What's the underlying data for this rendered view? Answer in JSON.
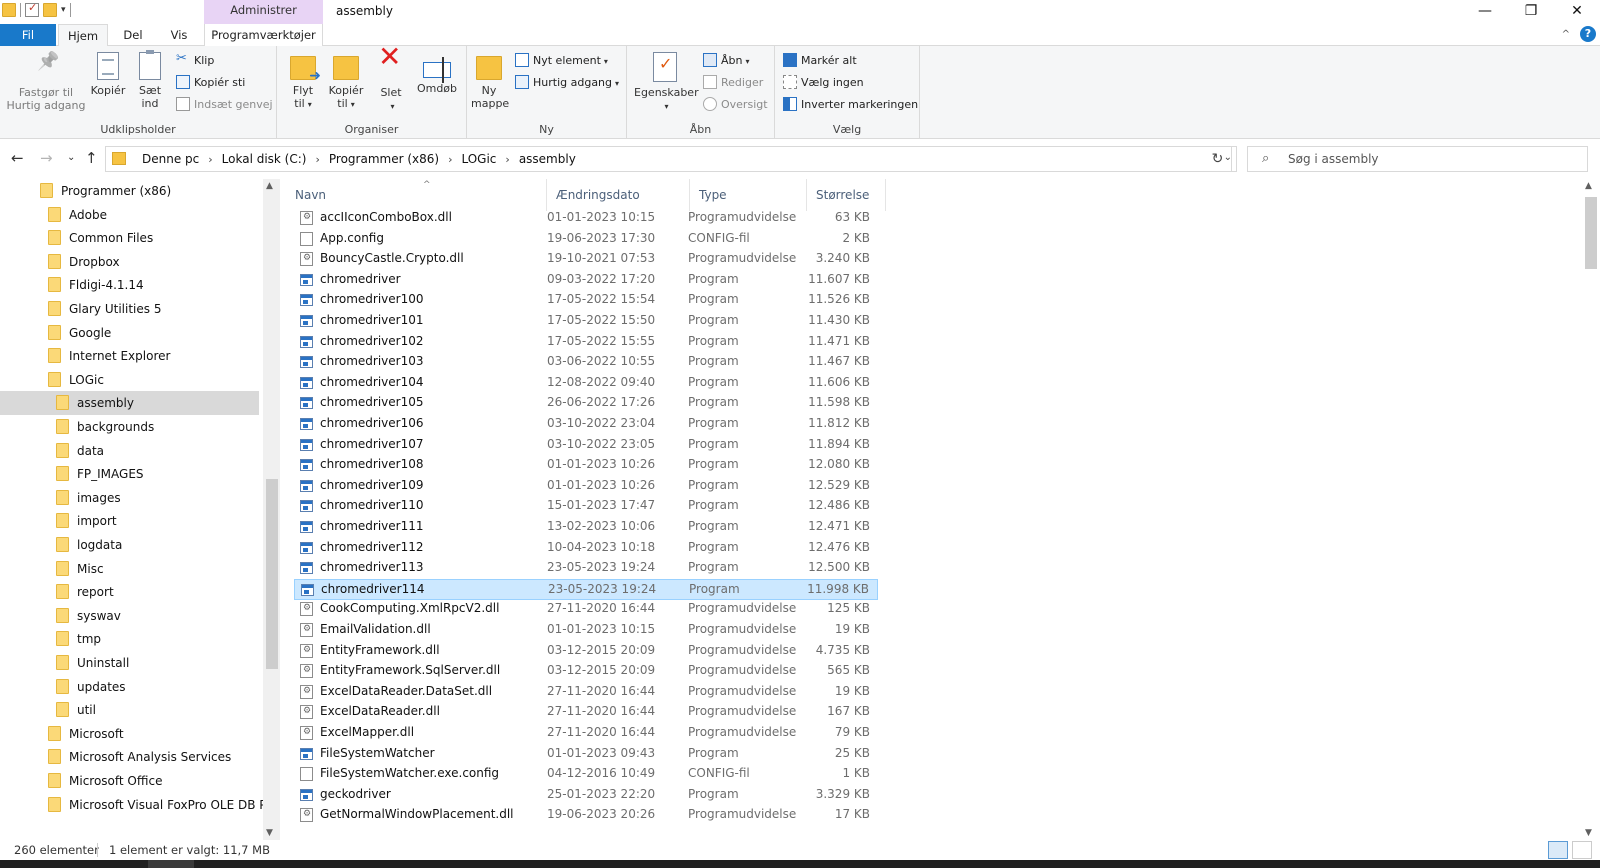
{
  "titlebar": {
    "title": "assembly",
    "context_tab": "Administrer",
    "minimize": "—",
    "maximize": "❐",
    "close": "✕"
  },
  "tabs": {
    "fil": "Fil",
    "hjem": "Hjem",
    "del": "Del",
    "vis": "Vis",
    "programvaerktojer": "Programværktøjer",
    "collapse": "^",
    "help": "?"
  },
  "ribbon": {
    "udklipsholder": {
      "label": "Udklipsholder",
      "pin_line1": "Fastgør til",
      "pin_line2": "Hurtig adgang",
      "copy": "Kopiér",
      "paste_line1": "Sæt",
      "paste_line2": "ind",
      "cut": "Klip",
      "copy_path": "Kopiér sti",
      "paste_shortcut": "Indsæt genvej"
    },
    "organiser": {
      "label": "Organiser",
      "move_line1": "Flyt",
      "move_line2": "til",
      "copyto_line1": "Kopiér",
      "copyto_line2": "til",
      "delete": "Slet",
      "rename": "Omdøb"
    },
    "ny": {
      "label": "Ny",
      "new_folder_line1": "Ny",
      "new_folder_line2": "mappe",
      "new_item": "Nyt element",
      "easy_access": "Hurtig adgang"
    },
    "aabn": {
      "label": "Åbn",
      "properties": "Egenskaber",
      "open": "Åbn",
      "edit": "Rediger",
      "history": "Oversigt"
    },
    "vaelg": {
      "label": "Vælg",
      "select_all": "Markér alt",
      "select_none": "Vælg ingen",
      "invert": "Inverter markeringen"
    }
  },
  "address": {
    "crumbs": [
      "Denne pc",
      "Lokal disk (C:)",
      "Programmer (x86)",
      "LOGic",
      "assembly"
    ],
    "search_placeholder": "Søg i assembly"
  },
  "nav_pane": {
    "items": [
      {
        "label": "Programmer (x86)",
        "level": 0
      },
      {
        "label": "Adobe",
        "level": 1
      },
      {
        "label": "Common Files",
        "level": 1
      },
      {
        "label": "Dropbox",
        "level": 1
      },
      {
        "label": "Fldigi-4.1.14",
        "level": 1
      },
      {
        "label": "Glary Utilities 5",
        "level": 1
      },
      {
        "label": "Google",
        "level": 1
      },
      {
        "label": "Internet Explorer",
        "level": 1
      },
      {
        "label": "LOGic",
        "level": 1
      },
      {
        "label": "assembly",
        "level": 2,
        "selected": true
      },
      {
        "label": "backgrounds",
        "level": 2
      },
      {
        "label": "data",
        "level": 2
      },
      {
        "label": "FP_IMAGES",
        "level": 2
      },
      {
        "label": "images",
        "level": 2
      },
      {
        "label": "import",
        "level": 2
      },
      {
        "label": "logdata",
        "level": 2
      },
      {
        "label": "Misc",
        "level": 2
      },
      {
        "label": "report",
        "level": 2
      },
      {
        "label": "syswav",
        "level": 2
      },
      {
        "label": "tmp",
        "level": 2
      },
      {
        "label": "Uninstall",
        "level": 2
      },
      {
        "label": "updates",
        "level": 2
      },
      {
        "label": "util",
        "level": 2
      },
      {
        "label": "Microsoft",
        "level": 1
      },
      {
        "label": "Microsoft Analysis Services",
        "level": 1
      },
      {
        "label": "Microsoft Office",
        "level": 1
      },
      {
        "label": "Microsoft Visual FoxPro OLE DB Prov",
        "level": 1
      }
    ]
  },
  "file_list": {
    "columns": {
      "name": "Navn",
      "date": "Ændringsdato",
      "type": "Type",
      "size": "Størrelse"
    },
    "rows": [
      {
        "icon": "dll-file-icon",
        "name": "accIIconComboBox.dll",
        "date": "01-01-2023 10:15",
        "type": "Programudvidelse",
        "size": "63 KB"
      },
      {
        "icon": "config-file-icon",
        "name": "App.config",
        "date": "19-06-2023 17:30",
        "type": "CONFIG-fil",
        "size": "2 KB"
      },
      {
        "icon": "dll-file-icon",
        "name": "BouncyCastle.Crypto.dll",
        "date": "19-10-2021 07:53",
        "type": "Programudvidelse",
        "size": "3.240 KB"
      },
      {
        "icon": "program-icon",
        "name": "chromedriver",
        "date": "09-03-2022 17:20",
        "type": "Program",
        "size": "11.607 KB"
      },
      {
        "icon": "program-icon",
        "name": "chromedriver100",
        "date": "17-05-2022 15:54",
        "type": "Program",
        "size": "11.526 KB"
      },
      {
        "icon": "program-icon",
        "name": "chromedriver101",
        "date": "17-05-2022 15:50",
        "type": "Program",
        "size": "11.430 KB"
      },
      {
        "icon": "program-icon",
        "name": "chromedriver102",
        "date": "17-05-2022 15:55",
        "type": "Program",
        "size": "11.471 KB"
      },
      {
        "icon": "program-icon",
        "name": "chromedriver103",
        "date": "03-06-2022 10:55",
        "type": "Program",
        "size": "11.467 KB"
      },
      {
        "icon": "program-icon",
        "name": "chromedriver104",
        "date": "12-08-2022 09:40",
        "type": "Program",
        "size": "11.606 KB"
      },
      {
        "icon": "program-icon",
        "name": "chromedriver105",
        "date": "26-06-2022 17:26",
        "type": "Program",
        "size": "11.598 KB"
      },
      {
        "icon": "program-icon",
        "name": "chromedriver106",
        "date": "03-10-2022 23:04",
        "type": "Program",
        "size": "11.812 KB"
      },
      {
        "icon": "program-icon",
        "name": "chromedriver107",
        "date": "03-10-2022 23:05",
        "type": "Program",
        "size": "11.894 KB"
      },
      {
        "icon": "program-icon",
        "name": "chromedriver108",
        "date": "01-01-2023 10:26",
        "type": "Program",
        "size": "12.080 KB"
      },
      {
        "icon": "program-icon",
        "name": "chromedriver109",
        "date": "01-01-2023 10:26",
        "type": "Program",
        "size": "12.529 KB"
      },
      {
        "icon": "program-icon",
        "name": "chromedriver110",
        "date": "15-01-2023 17:47",
        "type": "Program",
        "size": "12.486 KB"
      },
      {
        "icon": "program-icon",
        "name": "chromedriver111",
        "date": "13-02-2023 10:06",
        "type": "Program",
        "size": "12.471 KB"
      },
      {
        "icon": "program-icon",
        "name": "chromedriver112",
        "date": "10-04-2023 10:18",
        "type": "Program",
        "size": "12.476 KB"
      },
      {
        "icon": "program-icon",
        "name": "chromedriver113",
        "date": "23-05-2023 19:24",
        "type": "Program",
        "size": "12.500 KB"
      },
      {
        "icon": "program-icon",
        "name": "chromedriver114",
        "date": "23-05-2023 19:24",
        "type": "Program",
        "size": "11.998 KB",
        "selected": true
      },
      {
        "icon": "dll-file-icon",
        "name": "CookComputing.XmlRpcV2.dll",
        "date": "27-11-2020 16:44",
        "type": "Programudvidelse",
        "size": "125 KB"
      },
      {
        "icon": "dll-file-icon",
        "name": "EmailValidation.dll",
        "date": "01-01-2023 10:15",
        "type": "Programudvidelse",
        "size": "19 KB"
      },
      {
        "icon": "dll-file-icon",
        "name": "EntityFramework.dll",
        "date": "03-12-2015 20:09",
        "type": "Programudvidelse",
        "size": "4.735 KB"
      },
      {
        "icon": "dll-file-icon",
        "name": "EntityFramework.SqlServer.dll",
        "date": "03-12-2015 20:09",
        "type": "Programudvidelse",
        "size": "565 KB"
      },
      {
        "icon": "dll-file-icon",
        "name": "ExcelDataReader.DataSet.dll",
        "date": "27-11-2020 16:44",
        "type": "Programudvidelse",
        "size": "19 KB"
      },
      {
        "icon": "dll-file-icon",
        "name": "ExcelDataReader.dll",
        "date": "27-11-2020 16:44",
        "type": "Programudvidelse",
        "size": "167 KB"
      },
      {
        "icon": "dll-file-icon",
        "name": "ExcelMapper.dll",
        "date": "27-11-2020 16:44",
        "type": "Programudvidelse",
        "size": "79 KB"
      },
      {
        "icon": "program-icon",
        "name": "FileSystemWatcher",
        "date": "01-01-2023 09:43",
        "type": "Program",
        "size": "25 KB"
      },
      {
        "icon": "config-file-icon",
        "name": "FileSystemWatcher.exe.config",
        "date": "04-12-2016 10:49",
        "type": "CONFIG-fil",
        "size": "1 KB"
      },
      {
        "icon": "program-icon",
        "name": "geckodriver",
        "date": "25-01-2023 22:20",
        "type": "Program",
        "size": "3.329 KB"
      },
      {
        "icon": "dll-file-icon",
        "name": "GetNormalWindowPlacement.dll",
        "date": "19-06-2023 20:26",
        "type": "Programudvidelse",
        "size": "17 KB"
      }
    ]
  },
  "status": {
    "count": "260 elementer",
    "selection": "1 element er valgt: 11,7 MB"
  }
}
